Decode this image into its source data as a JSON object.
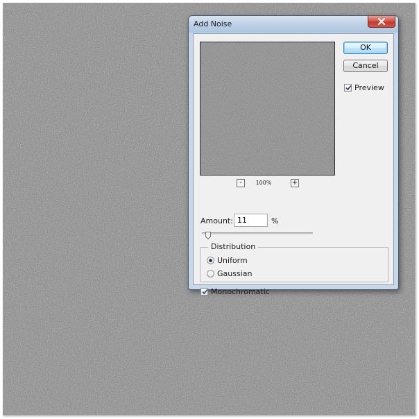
{
  "dialog": {
    "title": "Add Noise",
    "ok_label": "OK",
    "cancel_label": "Cancel",
    "preview_label": "Preview",
    "preview_checked": true,
    "zoom": {
      "minus": "-",
      "plus": "+",
      "level": "100%"
    },
    "amount": {
      "label": "Amount:",
      "value": "11",
      "unit": "%",
      "slider_fraction": 0.03
    },
    "distribution": {
      "legend": "Distribution",
      "options": [
        "Uniform",
        "Gaussian"
      ],
      "selected": "Uniform"
    },
    "monochromatic_label": "Monochromatic",
    "monochromatic_checked": true
  },
  "colors": {
    "canvas_noise_base": "#7a7a7a",
    "dialog_frame": "#c7d8eb",
    "close_button": "#c43a2c",
    "ok_button_border": "#3c7fb1",
    "window_background": "#f0f0f0"
  },
  "icons": {
    "close": "close-x-icon",
    "checkmark": "checkmark-icon"
  }
}
